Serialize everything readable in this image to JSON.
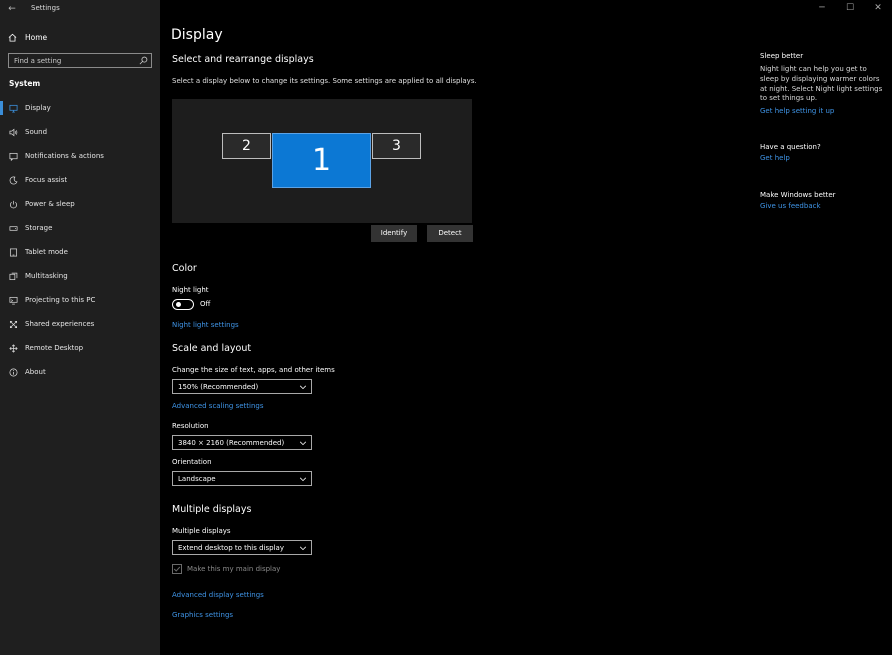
{
  "window": {
    "title": "Settings",
    "back": "←",
    "controls": {
      "minimize": "─",
      "maximize": "☐",
      "close": "✕"
    }
  },
  "sidebar": {
    "home_label": "Home",
    "search_placeholder": "Find a setting",
    "section": "System",
    "items": [
      {
        "label": "Display",
        "icon": "monitor-icon",
        "active": true
      },
      {
        "label": "Sound",
        "icon": "speaker-icon"
      },
      {
        "label": "Notifications & actions",
        "icon": "notification-icon"
      },
      {
        "label": "Focus assist",
        "icon": "moon-icon"
      },
      {
        "label": "Power & sleep",
        "icon": "power-icon"
      },
      {
        "label": "Storage",
        "icon": "storage-icon"
      },
      {
        "label": "Tablet mode",
        "icon": "tablet-icon"
      },
      {
        "label": "Multitasking",
        "icon": "multitasking-icon"
      },
      {
        "label": "Projecting to this PC",
        "icon": "projecting-icon"
      },
      {
        "label": "Shared experiences",
        "icon": "shared-icon"
      },
      {
        "label": "Remote Desktop",
        "icon": "remote-desktop-icon"
      },
      {
        "label": "About",
        "icon": "info-icon"
      }
    ]
  },
  "main": {
    "title": "Display",
    "arrange": {
      "heading": "Select and rearrange displays",
      "description": "Select a display below to change its settings. Some settings are applied to all displays.",
      "monitors": [
        "2",
        "1",
        "3"
      ],
      "identify_label": "Identify",
      "detect_label": "Detect"
    },
    "color": {
      "heading": "Color",
      "night_light_label": "Night light",
      "night_light_state": "Off",
      "night_light_settings_link": "Night light settings"
    },
    "scale": {
      "heading": "Scale and layout",
      "size_label": "Change the size of text, apps, and other items",
      "size_value": "150% (Recommended)",
      "advanced_scaling_link": "Advanced scaling settings",
      "resolution_label": "Resolution",
      "resolution_value": "3840 × 2160 (Recommended)",
      "orientation_label": "Orientation",
      "orientation_value": "Landscape"
    },
    "multiple": {
      "heading": "Multiple displays",
      "label": "Multiple displays",
      "value": "Extend desktop to this display",
      "main_display_label": "Make this my main display",
      "advanced_display_link": "Advanced display settings",
      "graphics_link": "Graphics settings"
    }
  },
  "right": {
    "sleep_heading": "Sleep better",
    "sleep_text": "Night light can help you get to sleep by displaying warmer colors at night. Select Night light settings to set things up.",
    "sleep_link": "Get help setting it up",
    "question_heading": "Have a question?",
    "question_link": "Get help",
    "better_heading": "Make Windows better",
    "better_link": "Give us feedback"
  },
  "colors": {
    "accent": "#0c78d4",
    "link": "#3f94e6",
    "sidebar_bg": "#1f1f1f"
  }
}
